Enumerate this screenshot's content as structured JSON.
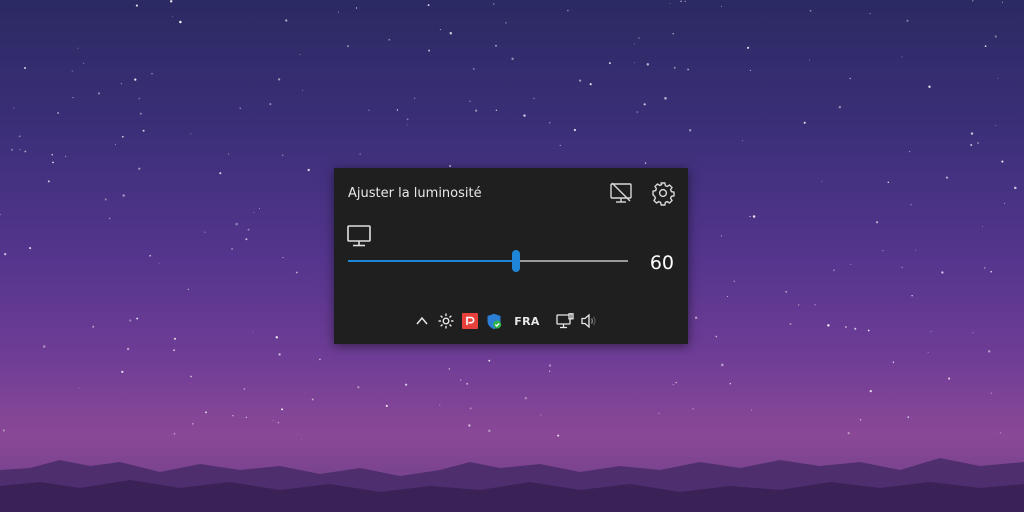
{
  "flyout": {
    "title": "Ajuster la luminosité",
    "brightness_value": "60",
    "brightness_level": 0.6,
    "icons": {
      "display_off": "display-off-icon",
      "settings": "gear-icon",
      "monitor": "monitor-icon"
    },
    "accent_color": "#1e86d6",
    "background_color": "#1f1f1f"
  },
  "tray": {
    "language": "FRA",
    "icons": [
      "chevron-up-icon",
      "brightness-sun-icon",
      "red-app-icon",
      "shield-check-icon",
      "network-icon",
      "volume-icon"
    ]
  }
}
